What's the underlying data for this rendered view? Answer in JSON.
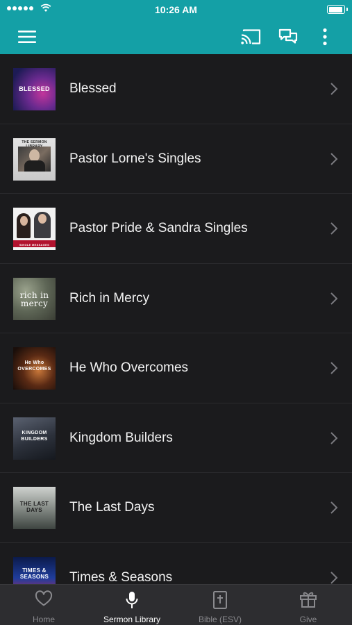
{
  "status_bar": {
    "time": "10:26 AM"
  },
  "app_bar": {
    "menu_icon": "hamburger-menu-icon",
    "cast_icon": "cast-icon",
    "chat_icon": "chat-icon",
    "more_icon": "more-vertical-icon",
    "background_color": "#14a0a6"
  },
  "sermon_series": [
    {
      "title": "Blessed",
      "thumb_text": "BLESSED"
    },
    {
      "title": "Pastor Lorne's Singles",
      "thumb_text": "THE SERMON LIBRARY"
    },
    {
      "title": "Pastor Pride & Sandra Singles",
      "thumb_text": "SINGLE MESSAGES"
    },
    {
      "title": "Rich in Mercy",
      "thumb_text": "rich in mercy"
    },
    {
      "title": "He Who Overcomes",
      "thumb_text": "He Who OVERCOMES"
    },
    {
      "title": "Kingdom Builders",
      "thumb_text": "KINGDOM BUILDERS"
    },
    {
      "title": "The Last Days",
      "thumb_text": "THE LAST DAYS"
    },
    {
      "title": "Times & Seasons",
      "thumb_text": "TIMES & SEASONS"
    }
  ],
  "tab_bar": {
    "tabs": [
      {
        "label": "Home",
        "icon": "heart-icon",
        "active": false
      },
      {
        "label": "Sermon Library",
        "icon": "microphone-icon",
        "active": true
      },
      {
        "label": "Bible (ESV)",
        "icon": "bible-icon",
        "active": false
      },
      {
        "label": "Give",
        "icon": "gift-icon",
        "active": false
      }
    ]
  }
}
